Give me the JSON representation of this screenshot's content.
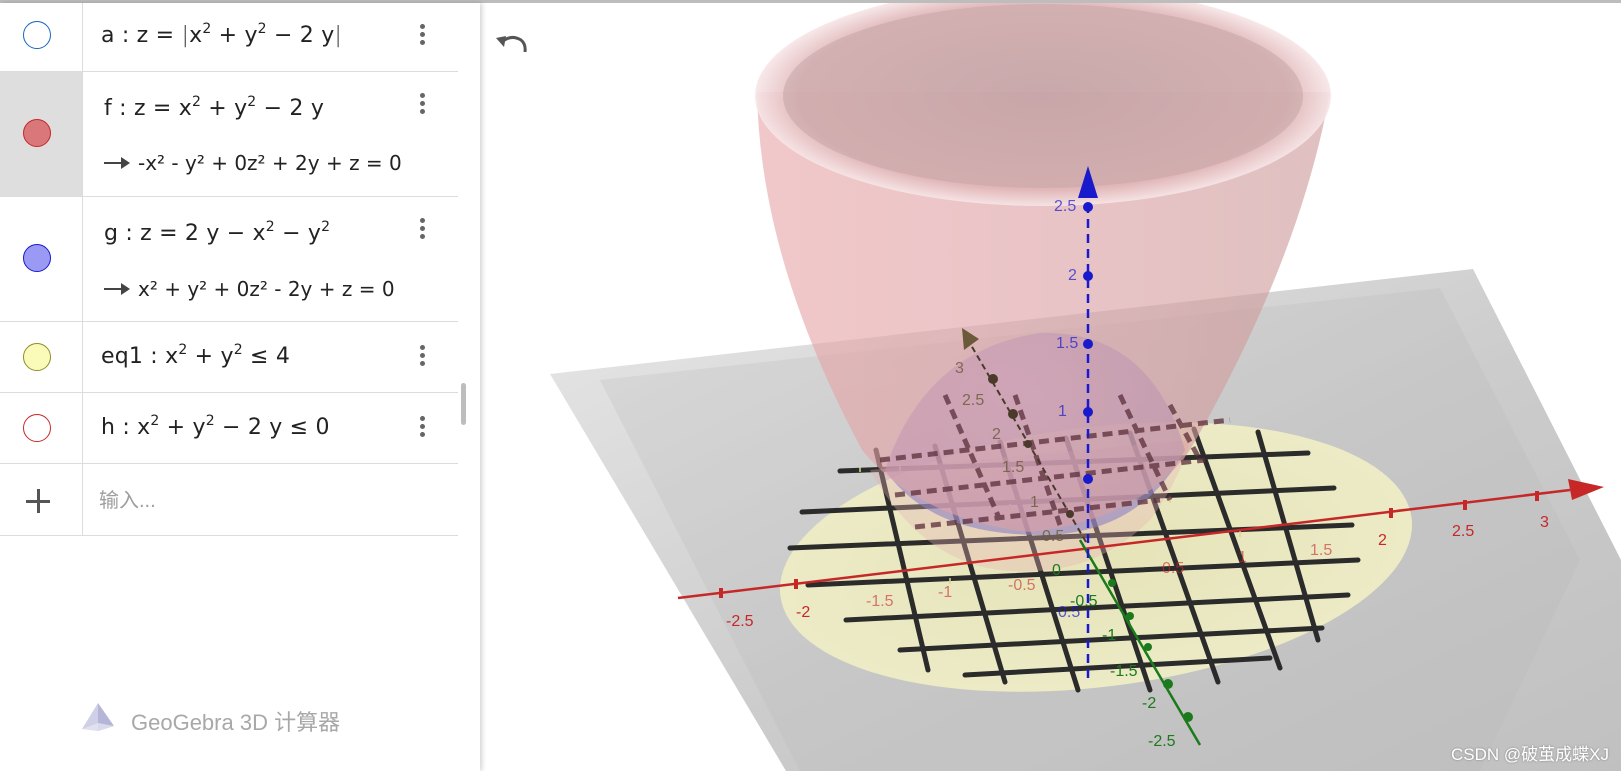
{
  "algebra": {
    "rows": [
      {
        "name": "a",
        "color": "#1565c0",
        "filled": false,
        "parts": {
          "lhs": "a : z = ",
          "b1": "|",
          "t1": "x",
          "e1": "2",
          "t2": " + y",
          "e2": "2",
          "t3": " − 2 y",
          "b2": "|"
        }
      },
      {
        "name": "f",
        "color": "#d32f2f",
        "filled": true,
        "fill": "#d9777a",
        "parts": {
          "t1": "f : z  =  x",
          "e1": "2",
          "t2": " + y",
          "e2": "2",
          "t3": " − 2 y"
        },
        "definition": "-x² - y² + 0z² + 2y + z = 0"
      },
      {
        "name": "g",
        "color": "#1a1acd",
        "filled": true,
        "fill": "#9a9af5",
        "parts": {
          "t1": "g : z  =  2 y − x",
          "e1": "2",
          "t2": " − y",
          "e2": "2"
        },
        "definition": "x² + y² + 0z² - 2y + z = 0"
      },
      {
        "name": "eq1",
        "color": "#8d8d2a",
        "filled": true,
        "fill": "#fbfbb9",
        "parts": {
          "t1": "eq1 : x",
          "e1": "2",
          "t2": " + y",
          "e2": "2",
          "t3": " ≤ 4"
        }
      },
      {
        "name": "h",
        "color": "#d32f2f",
        "filled": false,
        "parts": {
          "t1": "h : x",
          "e1": "2",
          "t2": " + y",
          "e2": "2",
          "t3": " − 2 y ≤ 0"
        }
      }
    ],
    "input_placeholder": "输入...",
    "brand": "GeoGebra 3D 计算器"
  },
  "icons": {
    "undo": "undo-icon",
    "menu": "more-vert-icon",
    "add": "plus-icon",
    "logo": "geogebra-logo-icon"
  },
  "view3d": {
    "x_ticks": [
      "-2.5",
      "-2",
      "-1.5",
      "-1",
      "-0.5",
      "0.5",
      "1",
      "1.5",
      "2",
      "2.5",
      "3"
    ],
    "y_ticks": [
      "-0.5",
      "-1",
      "-1.5",
      "-2",
      "-2.5",
      "0.5",
      "1",
      "1.5",
      "2",
      "2.5",
      "3"
    ],
    "z_ticks": [
      "0.5",
      "1",
      "1.5",
      "2",
      "2.5"
    ],
    "origin": "0"
  },
  "watermark": "CSDN @破茧成蝶XJ"
}
